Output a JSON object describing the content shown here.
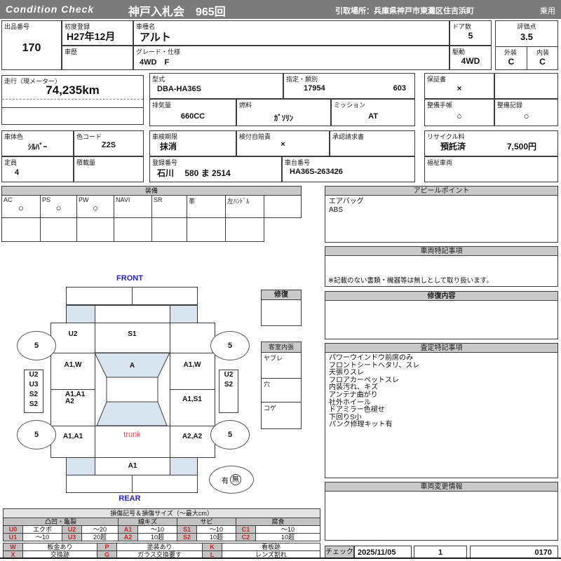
{
  "header": {
    "brand": "Condition  Check",
    "auction": "神戸入札会　965回",
    "pickup": "引取場所：兵庫県神戸市東灘区住吉浜町",
    "category": "乗用"
  },
  "info": {
    "lot_label": "出品番号",
    "lot": "170",
    "first_reg_label": "初度登録",
    "first_reg": "H27年12月",
    "history_label": "車歴",
    "model_label": "車種名",
    "model": "アルト",
    "grade_label": "グレード・仕様",
    "grade": "4WD　F",
    "doors_label": "ドア数",
    "doors": "5",
    "drive_label": "駆動",
    "drive": "4WD",
    "score_label": "評価点",
    "score": "3.5",
    "exterior_label": "外装",
    "exterior": "C",
    "interior_label": "内装",
    "interior": "C",
    "mileage_label": "走行（現メーター）",
    "mileage": "74,235km",
    "model_code_label": "型式",
    "model_code": "DBA-HA36S",
    "class_label": "指定・類別",
    "class_no1": "17954",
    "class_no2": "603",
    "displacement_label": "排気量",
    "displacement": "660CC",
    "fuel_label": "燃料",
    "fuel": "ｶﾞｿﾘﾝ",
    "mission_label": "ミッション",
    "mission": "AT",
    "warranty_label": "保証書",
    "warranty": "×",
    "maint_book_label": "整備手帳",
    "maint_book": "○",
    "maint_rec_label": "整備記録",
    "maint_rec": "○",
    "body_color_label": "車体色",
    "body_color": "ｼﾙﾊﾞｰ",
    "color_code_label": "色コード",
    "color_code": "Z2S",
    "capacity_label": "定員",
    "capacity": "4",
    "load_label": "積載量",
    "inspection_label": "車検期限",
    "inspection": "抹消",
    "insurance_label": "検付自賠責",
    "insurance": "×",
    "approval_label": "承認請求書",
    "registration_label": "登録番号",
    "registration": "石川　 580 ま 2514",
    "chassis_label": "車台番号",
    "chassis": "HA36S-263426",
    "recycle_label": "リサイクル料",
    "recycle_status": "預託済",
    "recycle_fee": "7,500円",
    "welfare_label": "福祉車両"
  },
  "equipment": {
    "title": "装備",
    "items": [
      {
        "label": "AC",
        "value": "○"
      },
      {
        "label": "PS",
        "value": "○"
      },
      {
        "label": "PW",
        "value": "○"
      },
      {
        "label": "NAVI",
        "value": ""
      },
      {
        "label": "SR",
        "value": ""
      },
      {
        "label": "革",
        "value": ""
      },
      {
        "label": "左ﾊﾝﾄﾞﾙ",
        "value": ""
      }
    ]
  },
  "appeal": {
    "title": "アピールポイント",
    "lines": [
      "エアバッグ",
      "ABS"
    ]
  },
  "vehicle_notes": {
    "title": "車両特記事項",
    "disclaimer": "※記載のない書類・機器等は無しとして取り扱います。"
  },
  "repair": {
    "title": "修復内容"
  },
  "assessment": {
    "title": "査定特記事項",
    "lines": [
      "パワーウインドウ前席のみ",
      "フロントシートヘタリ、スレ",
      "天張りスレ",
      "フロアカーペットスレ",
      "内装汚れ、キズ",
      "アンテナ曲がり",
      "社外ホイール",
      "ドアミラー色褪せ",
      "下回りS小",
      "パンク修理キット有"
    ]
  },
  "change_info": {
    "title": "車両変更情報"
  },
  "check": {
    "label": "チェック",
    "date": "2025/11/05",
    "count": "1",
    "number": "0170"
  },
  "diagram": {
    "front_label": "FRONT",
    "rear_label": "REAR",
    "trunk_label": "trunk",
    "tires": {
      "fl": "5",
      "fr": "5",
      "rl": "5",
      "rr": "5"
    },
    "spare": {
      "yes": "有",
      "no": "無"
    },
    "panels": {
      "hood": "S1",
      "left_fender": "U2",
      "windshield": "A",
      "left_front_door": "A1,W",
      "right_front_door": "A1,W",
      "left_rear_door_line1": "A1,A1",
      "left_rear_door_line2": "A2",
      "right_rear_door": "A1,S1",
      "left_quarter": "A1,A1",
      "right_quarter": "A2,A2",
      "rear_panel": "A1",
      "left_side": [
        "U2",
        "U3",
        "S2",
        "S2"
      ],
      "right_side": [
        "U2",
        "S2"
      ]
    }
  },
  "side_legend": {
    "repair_title": "修復",
    "interior_title": "客室内張",
    "rows": [
      "ヤブレ",
      "穴",
      "コゲ"
    ]
  },
  "damage_legend": {
    "title": "損傷記号＆損傷サイズ（～最大cm）",
    "groups": [
      "凸凹・亀裂",
      "線キズ",
      "サビ",
      "腐食"
    ],
    "rows": [
      [
        "U0",
        "エクボ",
        "U2",
        "～20",
        "A1",
        "～10",
        "S1",
        "～10",
        "C1",
        "～10"
      ],
      [
        "U1",
        "～10",
        "U3",
        "20超",
        "A2",
        "10超",
        "S2",
        "10超",
        "C2",
        "10超"
      ]
    ],
    "extra_rows": [
      [
        "W",
        "板金あり",
        "P",
        "塗装あり",
        "K",
        "看板跡"
      ],
      [
        "X",
        "交換跡",
        "G",
        "ガラス交換要す",
        "L",
        "レンズ割れ"
      ]
    ]
  }
}
